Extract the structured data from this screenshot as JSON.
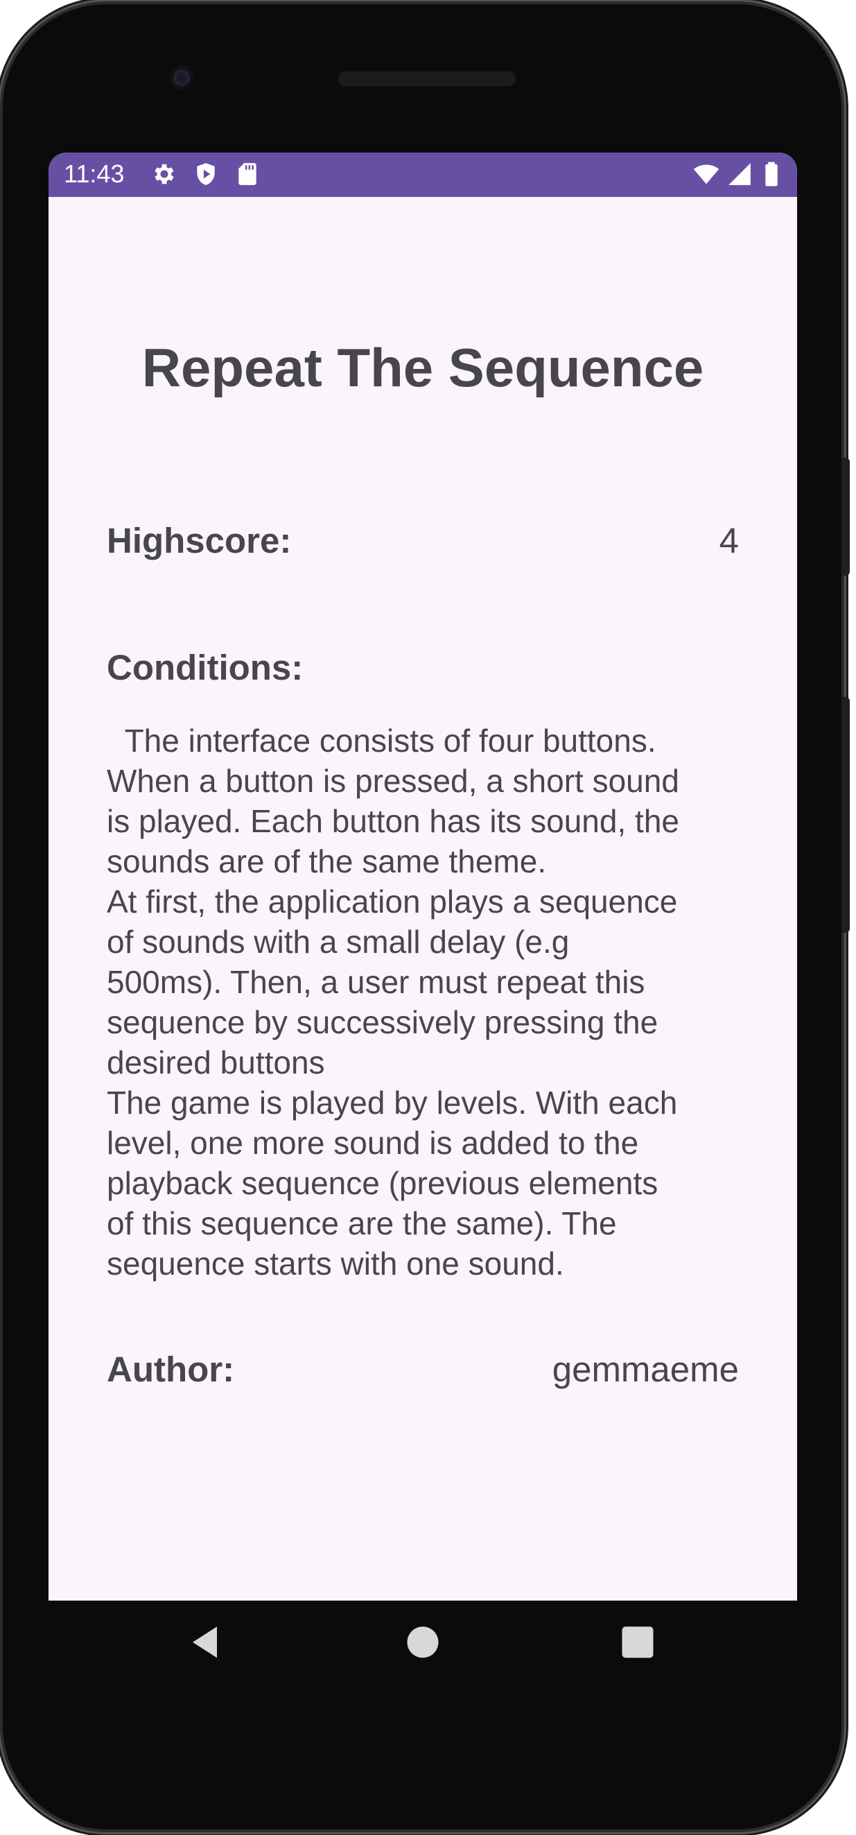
{
  "status_bar": {
    "time": "11:43",
    "left_icons": [
      "gear-icon",
      "play-shield-icon",
      "sd-card-icon"
    ],
    "right_icons": [
      "wifi-icon",
      "cell-signal-icon",
      "battery-icon"
    ],
    "background": "#6750a4"
  },
  "screen": {
    "title": "Repeat The Sequence",
    "highscore": {
      "label": "Highscore:",
      "value": "4"
    },
    "conditions": {
      "label": "Conditions:",
      "text": "  The interface consists of four buttons.\nWhen a button is pressed, a short sound\nis played. Each button has its sound, the\nsounds are of the same theme.\nAt first, the application plays a sequence\nof sounds with a small delay (e.g\n500ms). Then, a user must repeat this\nsequence by successively pressing the\ndesired buttons\nThe game is played by levels. With each\nlevel, one more sound is added to the\nplayback sequence (previous elements\nof this sequence are the same). The\nsequence starts with one sound."
    },
    "author": {
      "label": "Author:",
      "value": "gemmaeme"
    },
    "background": "#fbf5fb",
    "text_color": "#47464c"
  },
  "nav_bar": {
    "buttons": [
      "back-icon",
      "home-icon",
      "recents-icon"
    ]
  }
}
